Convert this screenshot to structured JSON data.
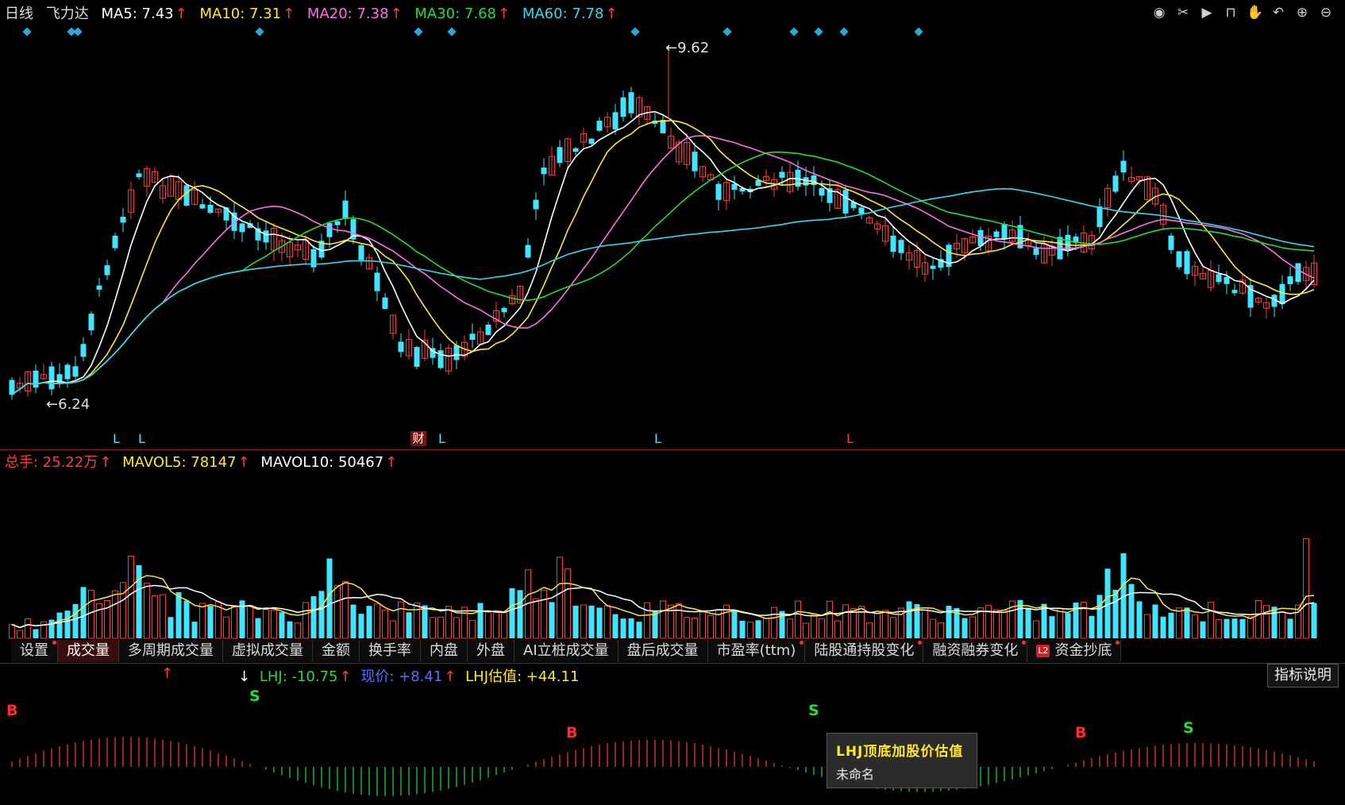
{
  "period_label": "日线",
  "stock_name": "飞力达",
  "ma": [
    {
      "label": "MA5: 7.43",
      "color": "#ffffff"
    },
    {
      "label": "MA10: 7.31",
      "color": "#ffe82a"
    },
    {
      "label": "MA20: 7.38",
      "color": "#ff6ee8"
    },
    {
      "label": "MA30: 7.68",
      "color": "#22dd33"
    },
    {
      "label": "MA60: 7.78",
      "color": "#35d8f0"
    }
  ],
  "up_arrow": "↑",
  "high_label": "←9.62",
  "low_label": "←6.24",
  "markers": {
    "l": "L",
    "cai": "财"
  },
  "volume": {
    "total": "总手: 25.22万",
    "mavol5": "MAVOL5: 78147",
    "mavol10": "MAVOL10: 50467"
  },
  "tabs": [
    {
      "label": "设置",
      "dot": true
    },
    {
      "label": "成交量",
      "active": true
    },
    {
      "label": "多周期成交量"
    },
    {
      "label": "虚拟成交量"
    },
    {
      "label": "金额"
    },
    {
      "label": "换手率"
    },
    {
      "label": "内盘"
    },
    {
      "label": "外盘"
    },
    {
      "label": "AI立桩成交量"
    },
    {
      "label": "盘后成交量"
    },
    {
      "label": "市盈率(ttm)",
      "dot": true
    },
    {
      "label": "陆股通持股变化",
      "dot": true
    },
    {
      "label": "融资融券变化",
      "dot": true
    },
    {
      "label": "资金抄底",
      "dot": true,
      "badge": "L2"
    }
  ],
  "indicator": {
    "lhj": "LHJ: -10.75",
    "price": "现价: +8.41",
    "est": "LHJ估值: +44.11",
    "help_button": "指标说明",
    "down_arrow": "↓"
  },
  "signals": {
    "buy": "B",
    "sell": "S"
  },
  "tooltip": {
    "title": "LHJ顶底加股价估值",
    "subtitle": "未命名"
  },
  "colors": {
    "up": "#ff3b3b",
    "down": "#40e6ff",
    "background": "#000000"
  }
}
